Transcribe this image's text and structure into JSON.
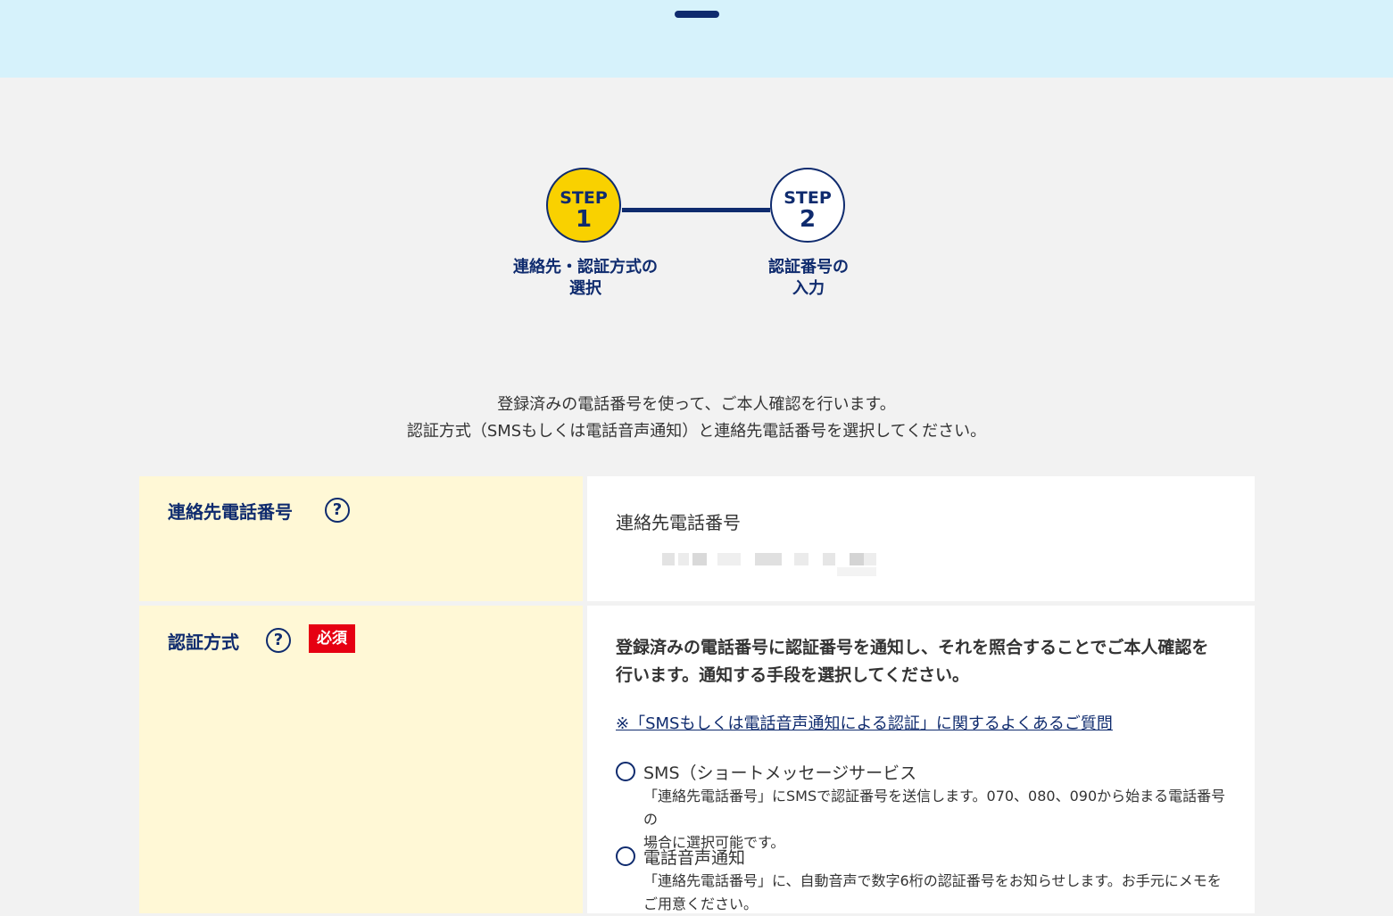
{
  "colors": {
    "navy": "#0f2b6e",
    "step_active": "#f9d100",
    "top_band": "#d6f2fb",
    "label_cell": "#fff8d6",
    "required_badge": "#e60012"
  },
  "stepper": {
    "steps": [
      {
        "word": "STEP",
        "number": "1",
        "label_line1": "連絡先・認証方式の",
        "label_line2": "選択",
        "state": "current"
      },
      {
        "word": "STEP",
        "number": "2",
        "label_line1": "認証番号の",
        "label_line2": "入力",
        "state": "upcoming"
      }
    ]
  },
  "intro": {
    "line1": "登録済みの電話番号を使って、ご本人確認を行います。",
    "line2": "認証方式（SMSもしくは電話音声通知）と連絡先電話番号を選択してください。"
  },
  "phone_row": {
    "label": "連絡先電話番号",
    "help_icon": "question-circle-icon",
    "help_glyph": "?",
    "value_label": "連絡先電話番号"
  },
  "method_row": {
    "label": "認証方式",
    "help_icon": "question-circle-icon",
    "help_glyph": "?",
    "required": "必須",
    "intro_line1": "登録済みの電話番号に認証番号を通知し、それを照合することでご本人確認を",
    "intro_line2": "行います。通知する手段を選択してください。",
    "faq_link": "※「SMSもしくは電話音声通知による認証」に関するよくあるご質問",
    "options": [
      {
        "title": "SMS（ショートメッセージサービス",
        "desc_line1": "「連絡先電話番号」にSMSで認証番号を送信します。070、080、090から始まる電話番号の",
        "desc_line2": "場合に選択可能です。",
        "selected": false
      },
      {
        "title": "電話音声通知",
        "desc_line1": "「連絡先電話番号」に、自動音声で数字6桁の認証番号をお知らせします。お手元にメモを",
        "desc_line2": "ご用意ください。",
        "selected": false
      }
    ]
  }
}
